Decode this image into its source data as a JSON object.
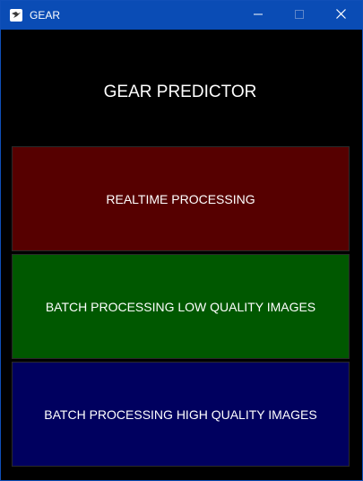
{
  "window": {
    "title": "GEAR",
    "app_icon": "bird-logo-icon",
    "controls": {
      "minimize_icon": "minimize-icon",
      "maximize_icon": "maximize-icon",
      "close_icon": "close-icon"
    }
  },
  "main": {
    "heading": "GEAR PREDICTOR",
    "buttons": [
      {
        "label": "REALTIME PROCESSING",
        "color": "#560000"
      },
      {
        "label": "BATCH PROCESSING LOW QUALITY IMAGES",
        "color": "#005800"
      },
      {
        "label": "BATCH PROCESSING HIGH QUALITY IMAGES",
        "color": "#00005f"
      }
    ]
  },
  "colors": {
    "titlebar": "#0a4cb5",
    "background": "#000000"
  }
}
